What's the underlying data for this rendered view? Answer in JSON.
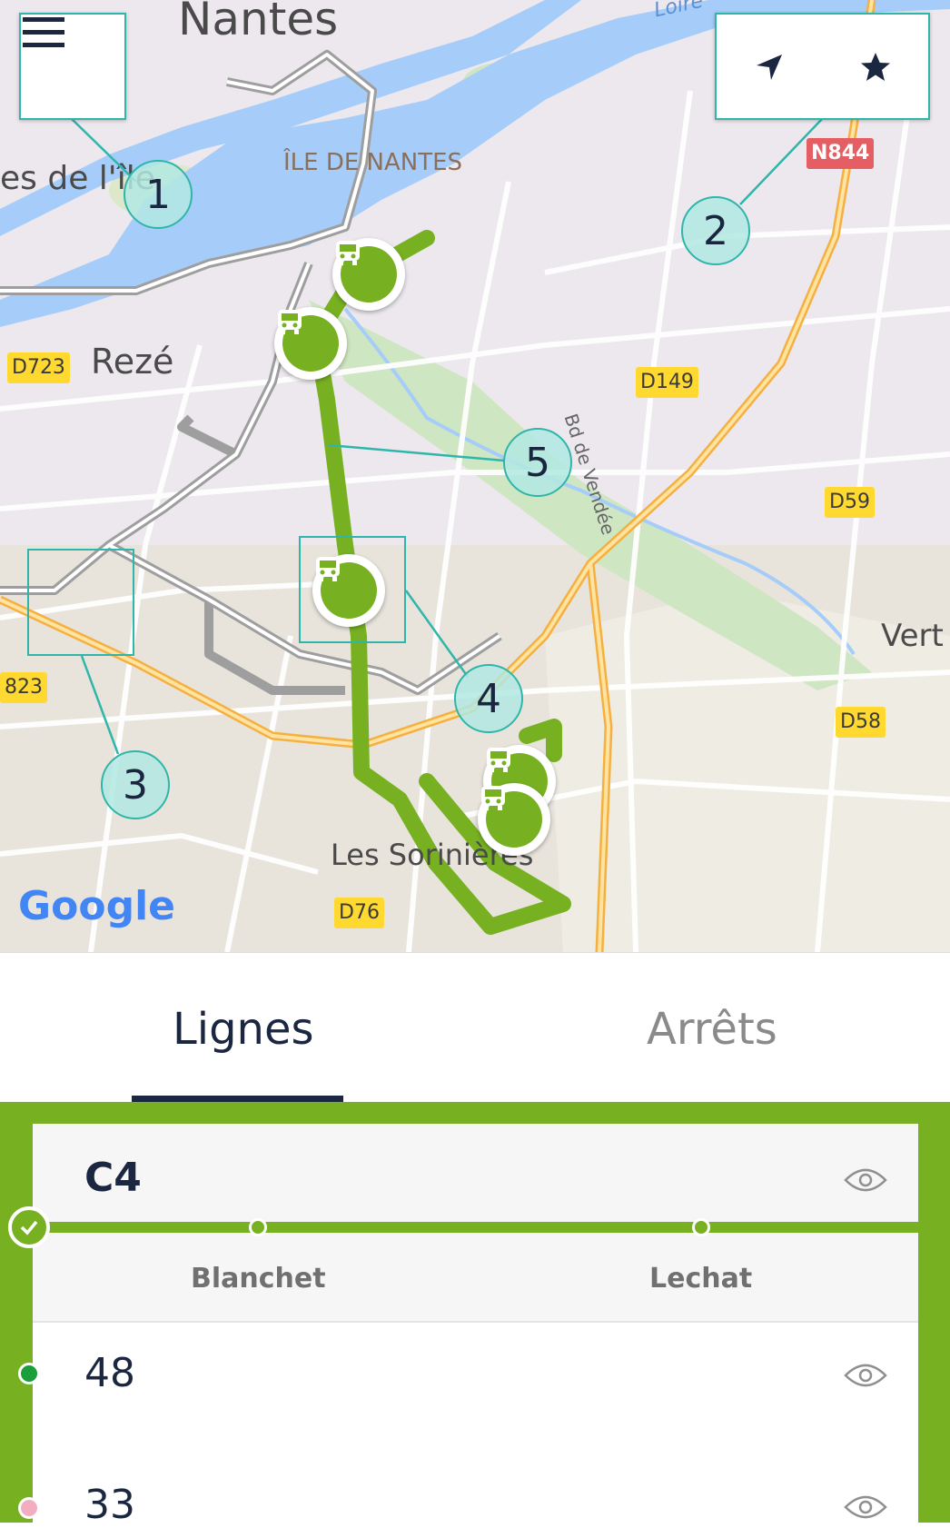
{
  "map": {
    "labels": {
      "city": "Nantes",
      "river": "Loire",
      "ile_de_nantes": "ÎLE DE NANTES",
      "partial_west": "es de l'île",
      "reze": "Rezé",
      "sorinieres": "Les Sorinières",
      "vertou_partial": "Vert",
      "bd_vendee": "Bd de Vendée"
    },
    "road_badges": {
      "n844": "N844",
      "d723": "D723",
      "d149": "D149",
      "d59": "D59",
      "d58": "D58",
      "d76": "D76",
      "d823_partial": "823"
    },
    "attribution": "Google",
    "colors": {
      "route": "#77b122",
      "highlight": "#2fb5a9"
    }
  },
  "controls": {
    "menu_icon": "menu-icon",
    "locate_icon": "navigation-arrow-icon",
    "favorite_icon": "star-icon"
  },
  "callouts": [
    "1",
    "2",
    "3",
    "4",
    "5"
  ],
  "tabs": {
    "lines": "Lignes",
    "stops": "Arrêts",
    "active": "Lignes"
  },
  "lines": [
    {
      "name": "C4",
      "selected": true,
      "color": "#77b122",
      "stops": [
        "Blanchet",
        "Lechat"
      ]
    },
    {
      "name": "48",
      "selected": false,
      "color": "#1a9e3a"
    },
    {
      "name": "33",
      "selected": false,
      "color": "#f2aec0"
    }
  ]
}
